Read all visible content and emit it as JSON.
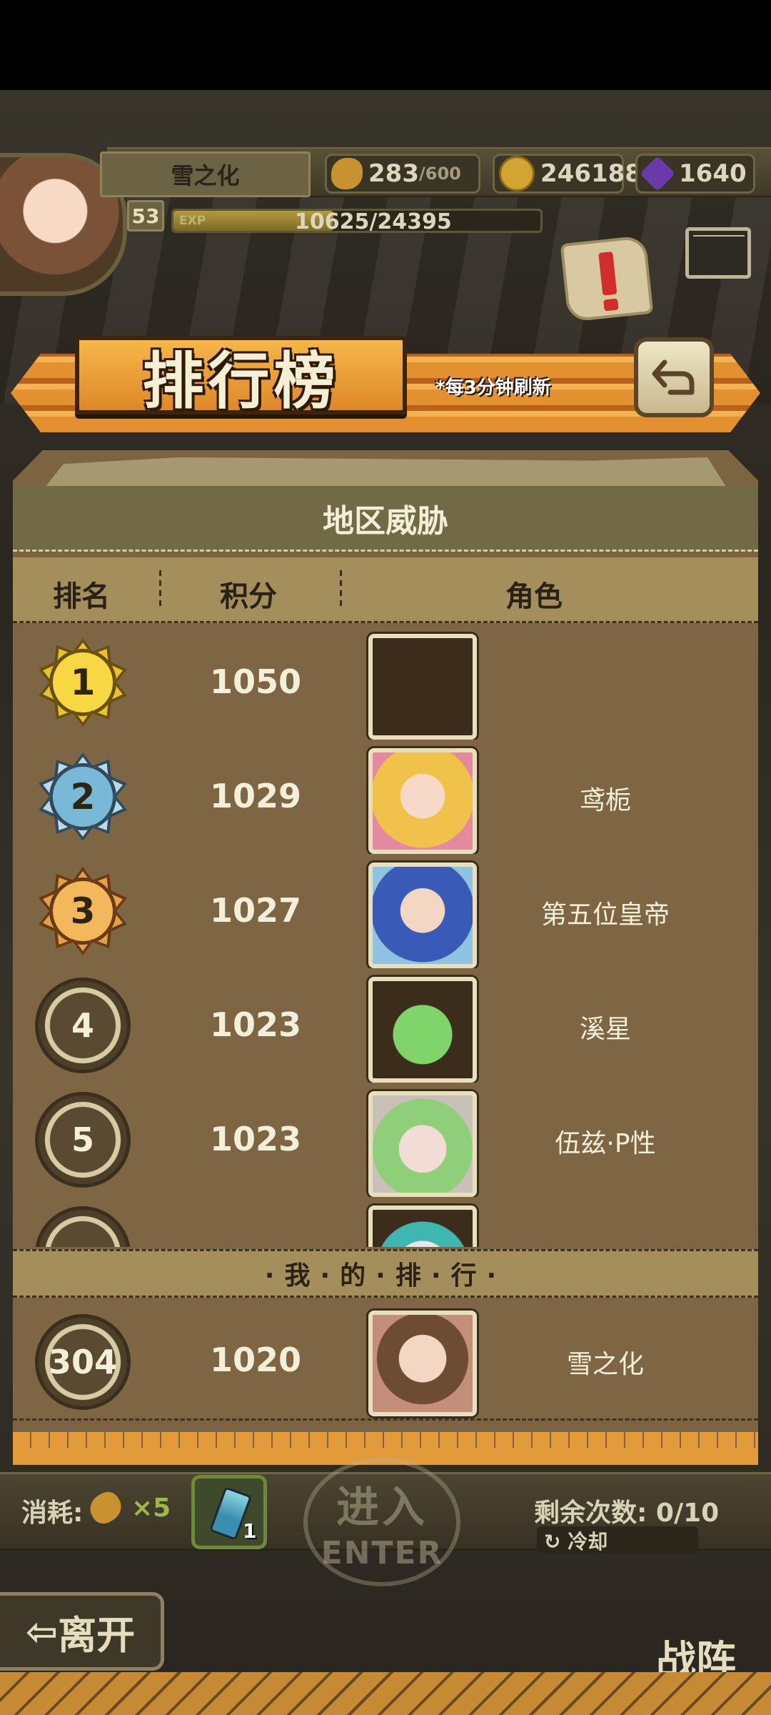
{
  "player": {
    "name": "雪之化",
    "level": "53",
    "exp_label": "EXP",
    "exp_text": "10625/24395",
    "exp_fraction": 0.4356
  },
  "resources": {
    "bread_current": "283",
    "bread_max": "/600",
    "gold": "246188",
    "gems": "1640"
  },
  "banner": {
    "title": "排行榜",
    "refresh_note": "*每3分钟刷新"
  },
  "leaderboard": {
    "region_title": "地区威胁",
    "columns": {
      "rank": "排名",
      "score": "积分",
      "role": "角色"
    },
    "rows": [
      {
        "rank": "1",
        "score": "1050",
        "name": "",
        "medal": "gold"
      },
      {
        "rank": "2",
        "score": "1029",
        "name": "鸢栀",
        "medal": "silver"
      },
      {
        "rank": "3",
        "score": "1027",
        "name": "第五位皇帝",
        "medal": "bronze"
      },
      {
        "rank": "4",
        "score": "1023",
        "name": "溪星",
        "medal": "plain"
      },
      {
        "rank": "5",
        "score": "1023",
        "name": "伍兹·P性",
        "medal": "plain"
      }
    ],
    "my_rank_title": "·我·的·排·行·",
    "my_rank": {
      "rank": "304",
      "score": "1020",
      "name": "雪之化"
    }
  },
  "bottom": {
    "consume_label": "消耗:",
    "consume_count": "×5",
    "potion_count": "1",
    "enter_cn": "进入",
    "enter_en": "ENTER",
    "remaining": "剩余次数: 0/10",
    "cooldown": "冷却",
    "leave": "离开",
    "team": "战阵"
  },
  "colors": {
    "accent_orange": "#e39030",
    "panel_brown": "#7e6644",
    "text_cream": "#f4efd8"
  }
}
